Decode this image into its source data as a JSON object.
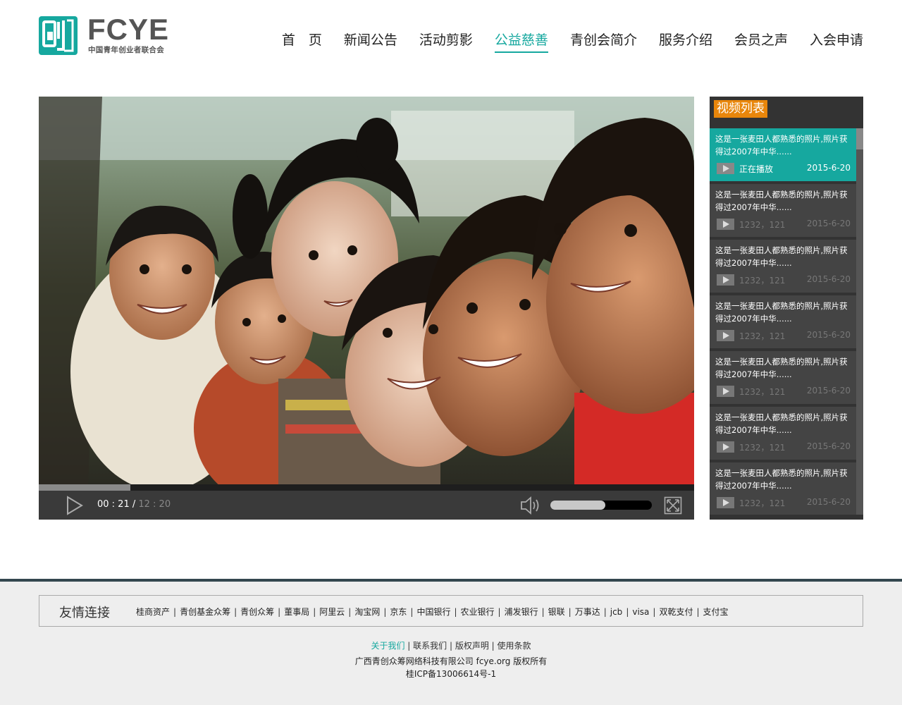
{
  "logo": {
    "name": "FCYE",
    "subtitle": "中国青年创业者联合会"
  },
  "nav": [
    {
      "label": "首　页",
      "active": false
    },
    {
      "label": "新闻公告",
      "active": false
    },
    {
      "label": "活动剪影",
      "active": false
    },
    {
      "label": "公益慈善",
      "active": true
    },
    {
      "label": "青创会简介",
      "active": false
    },
    {
      "label": "服务介绍",
      "active": false
    },
    {
      "label": "会员之声",
      "active": false
    },
    {
      "label": "入会申请",
      "active": false
    }
  ],
  "player": {
    "current_time": "00 : 21 / ",
    "total_time": "12 : 20",
    "progress_fraction": 0.14,
    "volume_fraction": 0.54
  },
  "sidebar": {
    "title": "视频列表",
    "items": [
      {
        "title": "这是一张麦田人都熟悉的照片,照片获得过2007年中华......",
        "stats": "正在播放",
        "date": "2015-6-20",
        "active": true
      },
      {
        "title": "这是一张麦田人都熟悉的照片,照片获得过2007年中华......",
        "stats": "1232，121",
        "date": "2015-6-20",
        "active": false
      },
      {
        "title": "这是一张麦田人都熟悉的照片,照片获得过2007年中华......",
        "stats": "1232，121",
        "date": "2015-6-20",
        "active": false
      },
      {
        "title": "这是一张麦田人都熟悉的照片,照片获得过2007年中华......",
        "stats": "1232，121",
        "date": "2015-6-20",
        "active": false
      },
      {
        "title": "这是一张麦田人都熟悉的照片,照片获得过2007年中华......",
        "stats": "1232，121",
        "date": "2015-6-20",
        "active": false
      },
      {
        "title": "这是一张麦田人都熟悉的照片,照片获得过2007年中华......",
        "stats": "1232，121",
        "date": "2015-6-20",
        "active": false
      },
      {
        "title": "这是一张麦田人都熟悉的照片,照片获得过2007年中华......",
        "stats": "1232，121",
        "date": "2015-6-20",
        "active": false
      }
    ]
  },
  "footer": {
    "links_title": "友情连接",
    "links": [
      "桂商资产",
      "青创基金众筹",
      "青创众筹",
      "董事局",
      "阿里云",
      "淘宝网",
      "京东",
      "中国银行",
      "农业银行",
      "浦发银行",
      "银联",
      "万事达",
      "jcb",
      "visa",
      "双乾支付",
      "支付宝"
    ],
    "bottom_links": [
      "关于我们",
      "联系我们",
      "版权声明",
      "使用条款"
    ],
    "copyright": "广西青创众筹网络科技有限公司 fcye.org 版权所有",
    "icp": "桂ICP备13006614号-1"
  },
  "colors": {
    "accent": "#16a89f",
    "orange": "#e8860b",
    "footer_border": "#34474f"
  }
}
